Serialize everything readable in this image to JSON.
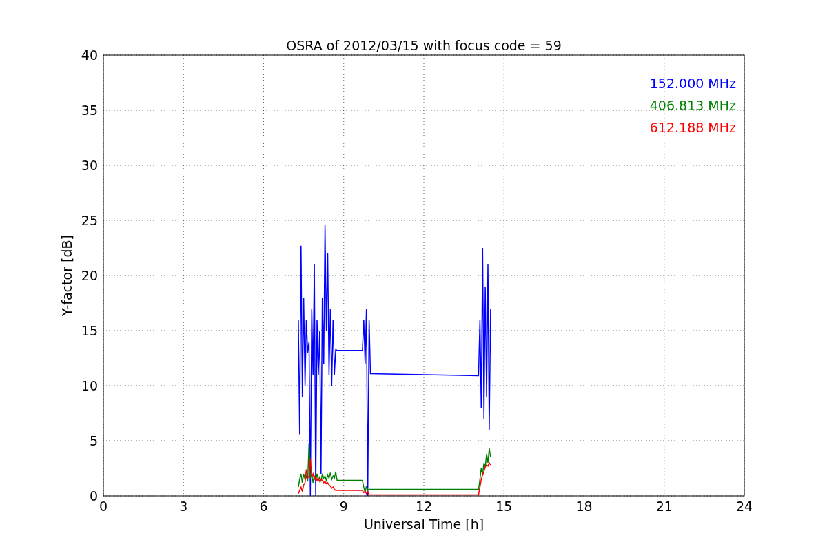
{
  "chart_data": {
    "type": "line",
    "title": "OSRA of 2012/03/15 with focus code = 59",
    "xlabel": "Universal Time [h]",
    "ylabel": "Y-factor [dB]",
    "grid": true,
    "xlim": [
      0,
      24
    ],
    "ylim": [
      0,
      40
    ],
    "xticks": [
      0,
      3,
      6,
      9,
      12,
      15,
      18,
      21,
      24
    ],
    "yticks": [
      0,
      5,
      10,
      15,
      20,
      25,
      30,
      35,
      40
    ],
    "x": [
      7.3,
      7.35,
      7.4,
      7.45,
      7.5,
      7.55,
      7.6,
      7.65,
      7.7,
      7.75,
      7.8,
      7.85,
      7.9,
      7.95,
      8.0,
      8.05,
      8.1,
      8.15,
      8.2,
      8.25,
      8.3,
      8.35,
      8.4,
      8.45,
      8.5,
      8.55,
      8.6,
      8.65,
      8.7,
      8.75,
      9.7,
      9.75,
      9.8,
      9.85,
      9.9,
      9.95,
      10.0,
      14.05,
      14.1,
      14.15,
      14.2,
      14.25,
      14.3,
      14.35,
      14.4,
      14.45,
      14.5
    ],
    "series": [
      {
        "name": "152.000 MHz",
        "color": "#0000ff",
        "values": [
          16,
          5.6,
          22.7,
          9,
          18,
          10,
          16,
          13,
          14,
          0,
          17,
          11,
          21,
          0,
          16,
          11,
          15,
          2,
          18,
          12,
          24.6,
          15,
          22,
          11,
          17,
          10,
          16,
          11,
          13.3,
          13.2,
          13.2,
          16,
          12,
          17,
          0,
          16,
          11.1,
          10.9,
          16,
          8,
          22.5,
          7,
          19,
          9,
          21,
          6,
          17
        ]
      },
      {
        "name": "406.813 MHz",
        "color": "#008000",
        "values": [
          0.8,
          1.5,
          2,
          1.2,
          2,
          1.5,
          1.8,
          1.3,
          4.8,
          1.6,
          2,
          1.2,
          1.8,
          1.5,
          2,
          1.4,
          1.7,
          1.3,
          2,
          1.6,
          1.8,
          1.4,
          1.9,
          1.6,
          2.1,
          1.5,
          1.8,
          1.6,
          2.2,
          1.4,
          1.4,
          0.8,
          0.3,
          0.9,
          0.5,
          0.6,
          0.6,
          0.6,
          1.5,
          2.5,
          2,
          3,
          2.6,
          3.8,
          3,
          4.3,
          3.5
        ]
      },
      {
        "name": "612.188 MHz",
        "color": "#ff0000",
        "values": [
          0.2,
          0.5,
          0.8,
          0.4,
          1,
          1.2,
          2.4,
          1.6,
          1.8,
          3.4,
          1.7,
          2,
          1.5,
          1.8,
          1.4,
          1.6,
          1.3,
          1.5,
          1.4,
          1.2,
          1.3,
          1.1,
          1.2,
          1,
          0.9,
          0.7,
          0.8,
          0.6,
          0.5,
          0.5,
          0.5,
          0.3,
          0.4,
          0.2,
          0.4,
          0.1,
          0.1,
          0.1,
          0.8,
          1.5,
          1.9,
          2.2,
          2.6,
          2.8,
          2.7,
          3,
          2.8
        ]
      }
    ]
  }
}
